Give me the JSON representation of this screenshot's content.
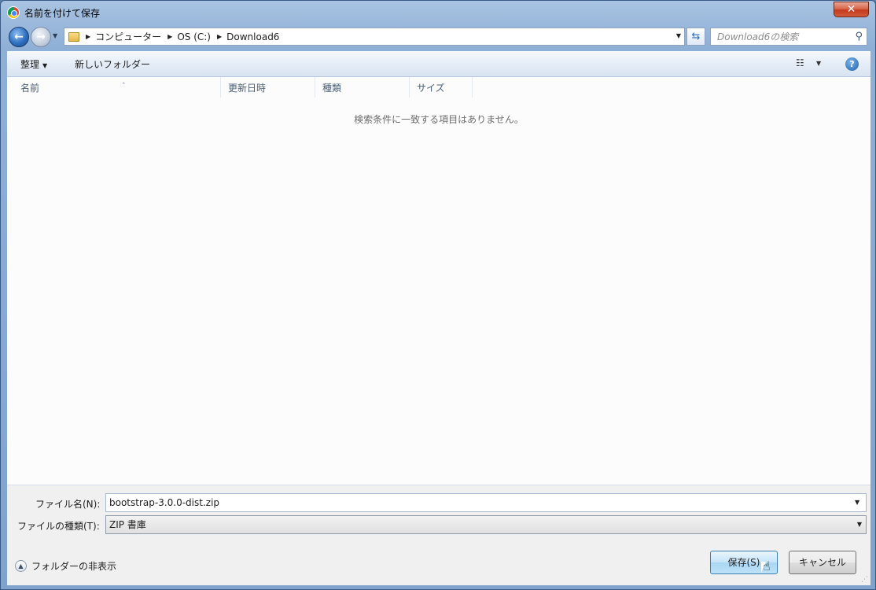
{
  "window": {
    "title": "名前を付けて保存",
    "close_label": "✕"
  },
  "nav": {
    "back_icon": "back-arrow-icon",
    "forward_icon": "forward-arrow-icon",
    "breadcrumbs": [
      "コンピューター",
      "OS (C:)",
      "Download6"
    ],
    "search_placeholder": "Download6の検索"
  },
  "toolbar": {
    "organize_label": "整理",
    "new_folder_label": "新しいフォルダー",
    "help_label": "?"
  },
  "filelist": {
    "columns": [
      "名前",
      "更新日時",
      "種類",
      "サイズ"
    ],
    "sort_indicator": "ˆ",
    "empty_message": "検索条件に一致する項目はありません。"
  },
  "bottom": {
    "filename_label": "ファイル名(N):",
    "filename_value": "bootstrap-3.0.0-dist.zip",
    "filetype_label": "ファイルの種類(T):",
    "filetype_value": "ZIP 書庫",
    "hide_folders_label": "フォルダーの非表示",
    "save_label": "保存(S)",
    "cancel_label": "キャンセル"
  },
  "colors": {
    "accent": "#3c7fb1",
    "titlebar": "#9bb9dc",
    "close": "#c4391d"
  }
}
